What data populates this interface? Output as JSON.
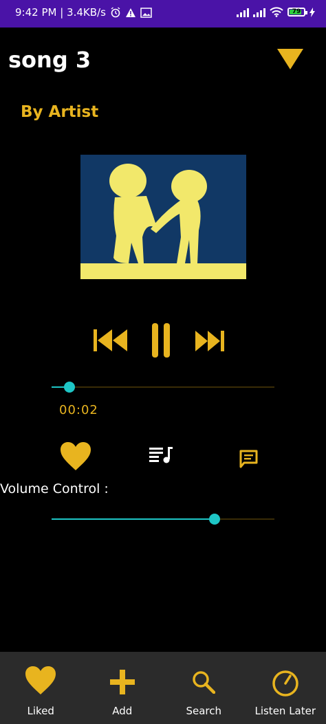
{
  "status_bar": {
    "time_speed": "9:42 PM | 3.4KB/s",
    "battery_level": "79",
    "icons": [
      "alarm-icon",
      "warning-icon",
      "image-icon",
      "signal-icon",
      "signal-icon",
      "wifi-icon",
      "battery-icon",
      "charging-icon"
    ]
  },
  "player": {
    "song_title": "song 3",
    "artist": "By Artist",
    "current_time": "00:02",
    "seek_progress": 0.08,
    "volume_label": "Volume Control :",
    "volume_level": 0.73
  },
  "colors": {
    "accent": "#e8b41f",
    "slider": "#1ec6c6",
    "status_bar": "#4a13a7",
    "nav_bg": "#2b2b2b"
  },
  "bottom_nav": {
    "items": [
      {
        "label": "Liked",
        "icon": "heart-icon"
      },
      {
        "label": "Add",
        "icon": "plus-icon"
      },
      {
        "label": "Search",
        "icon": "search-icon"
      },
      {
        "label": "Listen Later",
        "icon": "clock-icon"
      }
    ]
  }
}
